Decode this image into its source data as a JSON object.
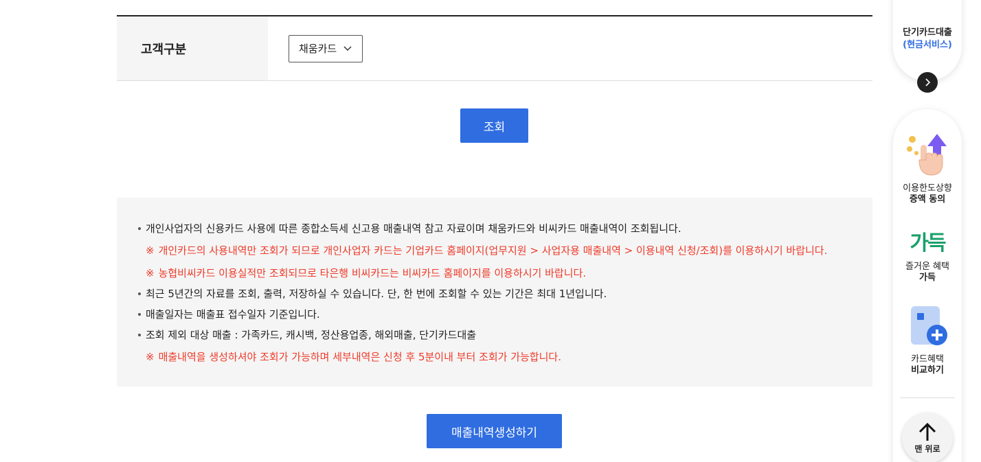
{
  "form": {
    "label": "고객구분",
    "select_value": "채움카드"
  },
  "buttons": {
    "search": "조회",
    "generate": "매출내역생성하기"
  },
  "notice": [
    {
      "type": "bullet",
      "text": "개인사업자의 신용카드 사용에 따른 종합소득세 신고용 매출내역 참고 자료이며 채움카드와 비씨카드 매출내역이 조회됩니다."
    },
    {
      "type": "warn",
      "mark": "※",
      "text": "개인카드의 사용내역만 조회가 되므로 개인사업자 카드는 기업카드 홈페이지(업무지원 > 사업자용 매출내역 > 이용내역 신청/조회)를 이용하시기 바랍니다."
    },
    {
      "type": "warn",
      "mark": "※",
      "text": "농협비씨카드 이용실적만 조회되므로 타은행 비씨카드는 비씨카드 홈페이지를 이용하시기 바랍니다."
    },
    {
      "type": "bullet",
      "text": "최근 5년간의 자료를 조회, 출력, 저장하실 수 있습니다. 단, 한 번에 조회할 수 있는 기간은 최대 1년입니다."
    },
    {
      "type": "bullet",
      "text": "매출일자는 매출표 접수일자 기준입니다."
    },
    {
      "type": "bullet",
      "text": "조회 제외 대상 매출 : 가족카드, 캐시백, 정산용업종, 해외매출, 단기카드대출"
    },
    {
      "type": "warn",
      "mark": "※",
      "text": "매출내역을 생성하셔야 조회가 가능하며 세부내역은 신청 후 5분이내 부터 조회가 가능합니다."
    }
  ],
  "quick_top": {
    "line1": "단기카드대출",
    "line2": "(현금서비스)"
  },
  "quick_menu": {
    "item1": {
      "line1": "이용한도상향",
      "line2": "증액 동의"
    },
    "item2": {
      "logo": "가득",
      "line1": "즐거운 혜택",
      "line2": "가득"
    },
    "item3": {
      "line1": "카드혜택",
      "line2": "비교하기"
    },
    "top": "맨 위로"
  },
  "colors": {
    "primary": "#2f6de1",
    "warn": "#ee3b2a",
    "panel": "#f5f5f5"
  }
}
